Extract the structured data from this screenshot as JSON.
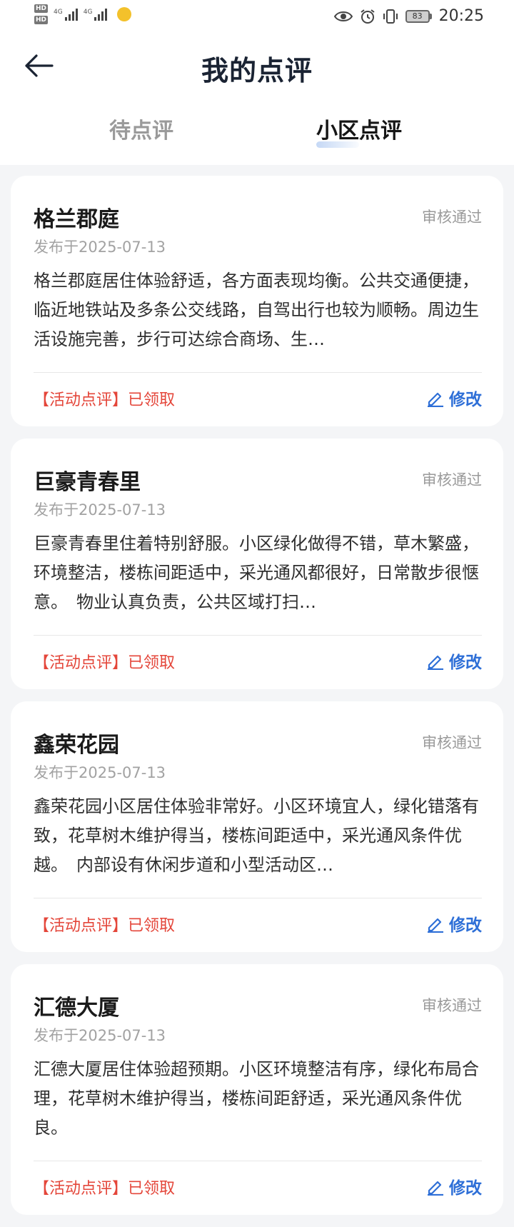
{
  "status_bar": {
    "sim1_label": "HD",
    "sim2_label": "HD",
    "net1": "4G",
    "net2": "4G",
    "battery": "83",
    "time": "20:25",
    "icons": [
      "eye-icon",
      "alarm-icon",
      "vibrate-icon",
      "battery-icon"
    ]
  },
  "header": {
    "title": "我的点评",
    "back_icon": "arrow-left-icon"
  },
  "tabs": [
    {
      "label": "待点评",
      "active": false
    },
    {
      "label": "小区点评",
      "active": true
    }
  ],
  "colors": {
    "accent": "#2e6fd7",
    "tag_red": "#e4463a",
    "background": "#f4f5f7"
  },
  "reviews": [
    {
      "name": "格兰郡庭",
      "status": "审核通过",
      "date": "发布于2025-07-13",
      "text": "格兰郡庭居住体验舒适，各方面表现均衡。公共交通便捷，临近地铁站及多条公交线路，自驾出行也较为顺畅。周边生活设施完善，步行可达综合商场、生…",
      "tag": "【活动点评】已领取",
      "edit_label": "修改"
    },
    {
      "name": "巨豪青春里",
      "status": "审核通过",
      "date": "发布于2025-07-13",
      "text": "巨豪青春里住着特别舒服。小区绿化做得不错，草木繁盛，环境整洁，楼栋间距适中，采光通风都很好，日常散步很惬意。　物业认真负责，公共区域打扫…",
      "tag": "【活动点评】已领取",
      "edit_label": "修改"
    },
    {
      "name": "鑫荣花园",
      "status": "审核通过",
      "date": "发布于2025-07-13",
      "text": "鑫荣花园小区居住体验非常好。小区环境宜人，绿化错落有致，花草树木维护得当，楼栋间距适中，采光通风条件优越。　内部设有休闲步道和小型活动区…",
      "tag": "【活动点评】已领取",
      "edit_label": "修改"
    },
    {
      "name": "汇德大厦",
      "status": "审核通过",
      "date": "发布于2025-07-13",
      "text": "汇德大厦居住体验超预期。小区环境整洁有序，绿化布局合理，花草树木维护得当，楼栋间距舒适，采光通风条件优良。",
      "tag": "【活动点评】已领取",
      "edit_label": "修改"
    }
  ]
}
